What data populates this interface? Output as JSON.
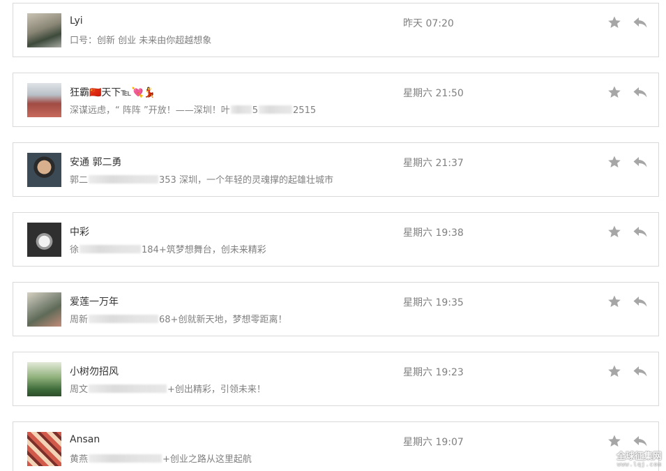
{
  "messages": [
    {
      "avatar": "avatar-person-outdoor",
      "name": "Lyi",
      "time": "昨天 07:20",
      "message_parts": [
        "口号：创新 创业 未来由你超越想象"
      ],
      "blur_widths": []
    },
    {
      "avatar": "avatar-running-track",
      "name": "狂霸🇨🇳天下℡💘💃",
      "time": "星期六 21:50",
      "message_parts": [
        "深谋远虑，“  阵阵  ”开放！——深圳！叶",
        "5",
        "2515"
      ],
      "blur_widths": [
        30,
        48
      ]
    },
    {
      "avatar": "avatar-man-portrait",
      "name": "安通 郭二勇",
      "time": "星期六 21:37",
      "message_parts": [
        "郭二",
        "353 深圳，一个年轻的灵魂撑的起雄壮城市"
      ],
      "blur_widths": [
        100
      ]
    },
    {
      "avatar": "avatar-snowflake-pendant",
      "name": "中彩",
      "time": "星期六 19:38",
      "message_parts": [
        "徐",
        "184+筑梦想舞台，创未来精彩"
      ],
      "blur_widths": [
        88
      ]
    },
    {
      "avatar": "avatar-tree-landscape",
      "name": "爱莲一万年",
      "time": "星期六 19:35",
      "message_parts": [
        "周新",
        "68+创就新天地，梦想零距离！"
      ],
      "blur_widths": [
        100
      ]
    },
    {
      "avatar": "avatar-green-tree",
      "name": "小树勿招风",
      "time": "星期六 19:23",
      "message_parts": [
        "周文",
        "+创出精彩，引领未来！"
      ],
      "blur_widths": [
        112
      ]
    },
    {
      "avatar": "avatar-cartoon-faces",
      "name": "Ansan",
      "time": "星期六 19:07",
      "message_parts": [
        "黄燕",
        "+创业之路从这里起航"
      ],
      "blur_widths": [
        105
      ]
    }
  ],
  "icons": {
    "star": "star-icon",
    "reply": "reply-icon"
  },
  "colors": {
    "icon_gray": "#a6a6a6",
    "name_text": "#333333",
    "meta_text": "#808080",
    "border": "#d9d9d9"
  },
  "watermark": {
    "text": "全球征集网",
    "url": "www.lqj.com"
  }
}
